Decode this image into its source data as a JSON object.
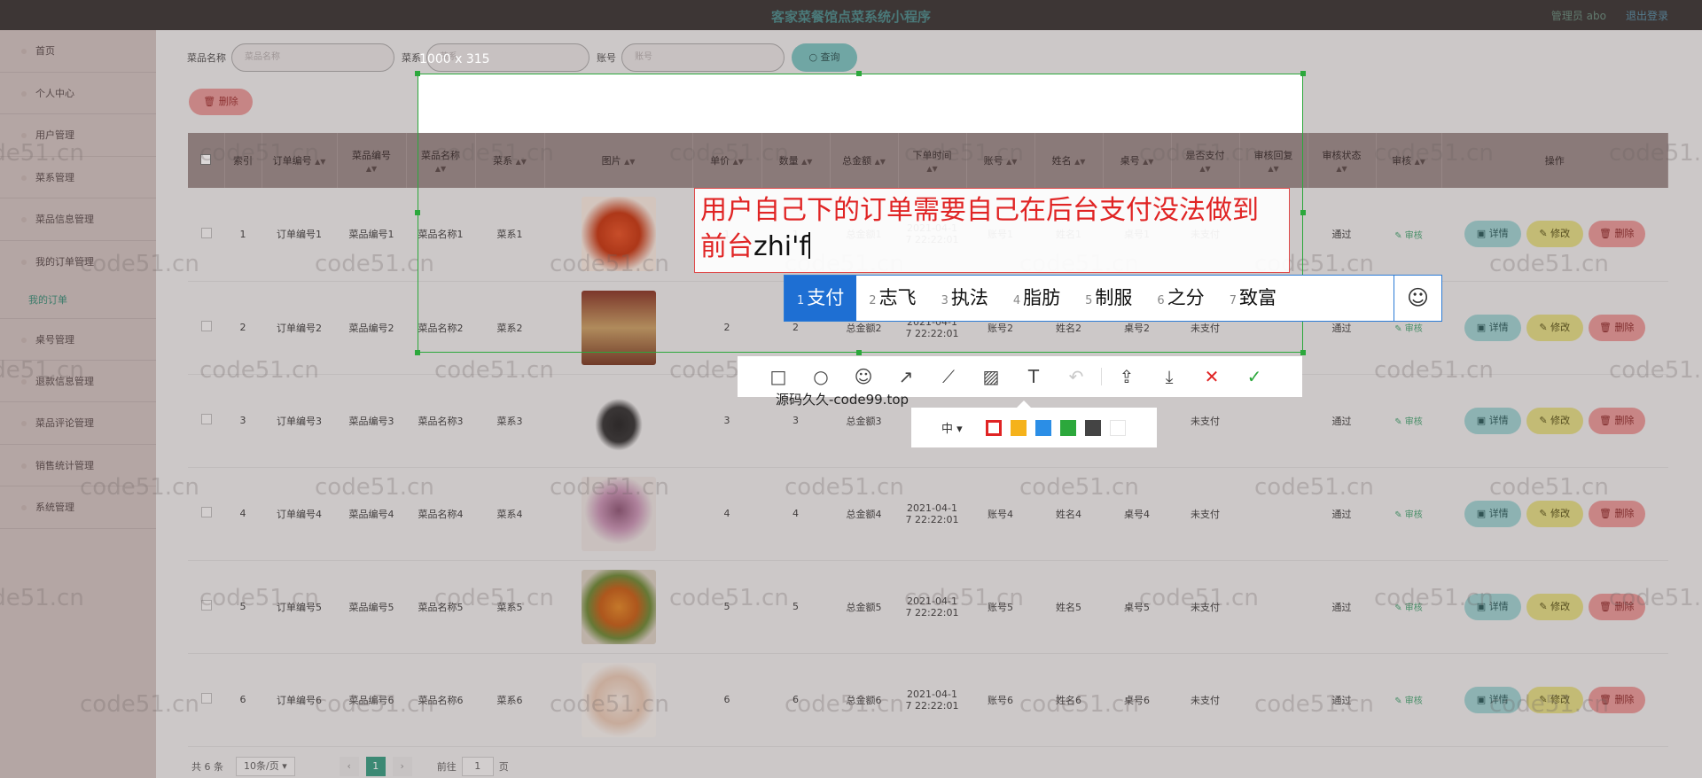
{
  "app": {
    "title": "客家菜餐馆点菜系统小程序",
    "admin": "管理员 abo",
    "logout": "退出登录"
  },
  "sidebar": {
    "items": [
      {
        "label": "首页"
      },
      {
        "label": "个人中心"
      },
      {
        "label": "用户管理"
      },
      {
        "label": "菜系管理"
      },
      {
        "label": "菜品信息管理"
      },
      {
        "label": "我的订单管理"
      },
      {
        "label": "我的订单"
      },
      {
        "label": "桌号管理"
      },
      {
        "label": "退款信息管理"
      },
      {
        "label": "菜品评论管理"
      },
      {
        "label": "销售统计管理"
      },
      {
        "label": "系统管理"
      }
    ]
  },
  "search": {
    "label1": "菜品名称",
    "placeholder1": "菜品名称",
    "label2": "菜系",
    "placeholder2": "菜系",
    "label3": "账号",
    "placeholder3": "账号",
    "button": "查询"
  },
  "actions": {
    "delete": "删除"
  },
  "table": {
    "headers": [
      "索引",
      "订单编号",
      "菜品编号",
      "菜品名称",
      "菜系",
      "图片",
      "单价",
      "数量",
      "总金额",
      "下单时间",
      "账号",
      "姓名",
      "桌号",
      "是否支付",
      "审核回复",
      "审核状态",
      "审核",
      "操作"
    ],
    "rows": [
      {
        "idx": "1",
        "order": "订单编号1",
        "code": "菜品编号1",
        "name": "菜品名称1",
        "cat": "菜系1",
        "price": "1",
        "qty": "1",
        "total": "总金额1",
        "time": "2021-04-1\n7 22:22:01",
        "account": "账号1",
        "person": "姓名1",
        "table": "桌号1",
        "paid": "未支付",
        "reply": "",
        "status": "通过"
      },
      {
        "idx": "2",
        "order": "订单编号2",
        "code": "菜品编号2",
        "name": "菜品名称2",
        "cat": "菜系2",
        "price": "2",
        "qty": "2",
        "total": "总金额2",
        "time": "2021-04-1\n7 22:22:01",
        "account": "账号2",
        "person": "姓名2",
        "table": "桌号2",
        "paid": "未支付",
        "reply": "",
        "status": "通过"
      },
      {
        "idx": "3",
        "order": "订单编号3",
        "code": "菜品编号3",
        "name": "菜品名称3",
        "cat": "菜系3",
        "price": "3",
        "qty": "3",
        "total": "总金额3",
        "time": "",
        "account": "",
        "person": "",
        "table": "",
        "paid": "未支付",
        "reply": "",
        "status": "通过"
      },
      {
        "idx": "4",
        "order": "订单编号4",
        "code": "菜品编号4",
        "name": "菜品名称4",
        "cat": "菜系4",
        "price": "4",
        "qty": "4",
        "total": "总金额4",
        "time": "2021-04-1\n7 22:22:01",
        "account": "账号4",
        "person": "姓名4",
        "table": "桌号4",
        "paid": "未支付",
        "reply": "",
        "status": "通过"
      },
      {
        "idx": "5",
        "order": "订单编号5",
        "code": "菜品编号5",
        "name": "菜品名称5",
        "cat": "菜系5",
        "price": "5",
        "qty": "5",
        "total": "总金额5",
        "time": "2021-04-1\n7 22:22:01",
        "account": "账号5",
        "person": "姓名5",
        "table": "桌号5",
        "paid": "未支付",
        "reply": "",
        "status": "通过"
      },
      {
        "idx": "6",
        "order": "订单编号6",
        "code": "菜品编号6",
        "name": "菜品名称6",
        "cat": "菜系6",
        "price": "6",
        "qty": "6",
        "total": "总金额6",
        "time": "2021-04-1\n7 22:22:01",
        "account": "账号6",
        "person": "姓名6",
        "table": "桌号6",
        "paid": "未支付",
        "reply": "",
        "status": "通过"
      }
    ],
    "audit_label": "审核",
    "op_detail": "详情",
    "op_edit": "修改",
    "op_delete": "删除"
  },
  "pager": {
    "total": "共 6 条",
    "page_size": "10条/页",
    "current": "1",
    "goto": "前往",
    "goto_value": "1",
    "page_unit": "页"
  },
  "watermark": "code51.cn",
  "screenshot": {
    "size_label": "1000 x 315",
    "annotation_text": "用户自己下的订单需要自己在后台支付没法做到前台",
    "typed_pinyin": "zhi'f",
    "ime_candidates": [
      {
        "n": "1",
        "w": "支付"
      },
      {
        "n": "2",
        "w": "志飞"
      },
      {
        "n": "3",
        "w": "执法"
      },
      {
        "n": "4",
        "w": "脂肪"
      },
      {
        "n": "5",
        "w": "制服"
      },
      {
        "n": "6",
        "w": "之分"
      },
      {
        "n": "7",
        "w": "致富"
      }
    ],
    "source_text": "源码久久-code99.top",
    "size_option": "中",
    "colors": [
      "#e02424",
      "#f5b21b",
      "#2b8ee6",
      "#2ca83c",
      "#444444",
      "#ffffff"
    ]
  }
}
